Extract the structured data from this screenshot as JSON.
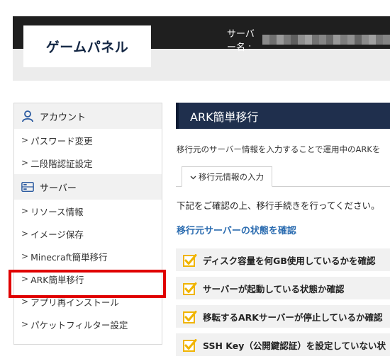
{
  "header": {
    "logo_text": "ゲームパネル",
    "server_label": "サーバー名 :",
    "mosaic_colors": [
      "#8a8a8a",
      "#6f6f6f",
      "#9a9a9a",
      "#7a7a7a",
      "#5f5f5f",
      "#8f8f8f",
      "#a3a3a3",
      "#737373",
      "#868686",
      "#6a6a6a",
      "#999999",
      "#7d7d7d",
      "#919191",
      "#656565",
      "#8c8c8c",
      "#a0a0a0",
      "#777777",
      "#858585"
    ]
  },
  "sidebar": {
    "account_section": "アカウント",
    "account_items": [
      "パスワード変更",
      "二段階認証設定"
    ],
    "server_section": "サーバー",
    "server_items": [
      "リソース情報",
      "イメージ保存",
      "Minecraft簡単移行",
      "ARK簡単移行",
      "アプリ再インストール",
      "パケットフィルター設定"
    ],
    "highlighted_item": "ARK簡単移行"
  },
  "main": {
    "title": "ARK簡単移行",
    "description": "移行元のサーバー情報を入力することで運用中のARKを",
    "tab_label": "移行元情報の入力",
    "confirm_text": "下記をご確認の上、移行手続きを行ってください。",
    "section_heading": "移行元サーバーの状態を確認",
    "checks": [
      "ディスク容量を何GB使用しているかを確認",
      "サーバーが起動している状態か確認",
      "移転するARKサーバーが停止しているか確認",
      "SSH Key（公開鍵認証）を設定していない状"
    ]
  },
  "colors": {
    "header_dark": "#1f1f1f",
    "title_bar": "#1f2f4d",
    "accent_blue": "#2b6cb0",
    "highlight_red": "#e00000",
    "check_yellow": "#f0b400"
  }
}
